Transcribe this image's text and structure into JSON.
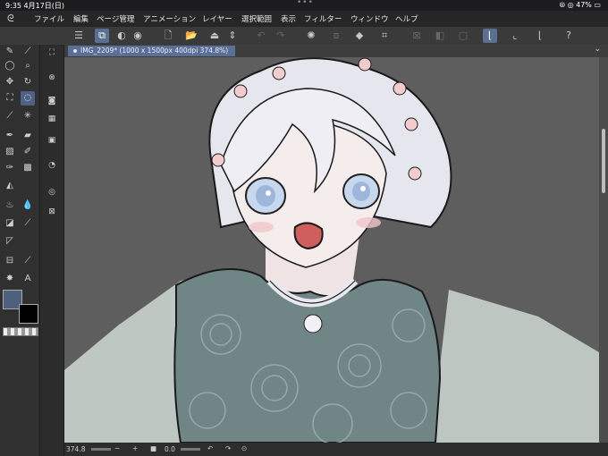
{
  "status_bar": {
    "time": "9:35",
    "date": "4月17日(日)",
    "battery": "47%"
  },
  "menu": {
    "items": [
      "ファイル",
      "編集",
      "ページ管理",
      "アニメーション",
      "レイヤー",
      "選択範囲",
      "表示",
      "フィルター",
      "ウィンドウ",
      "ヘルプ"
    ]
  },
  "document": {
    "tab_title": "IMG_2209* (1000 x 1500px 400dpi 374.8%)"
  },
  "bottom": {
    "zoom": "374.8",
    "rotation": "0.0"
  },
  "colors": {
    "main_color": "#4f5f7e",
    "sub_color": "#000000",
    "accent": "#5a6f96"
  },
  "icons": {
    "toolbar": [
      "menu-icon",
      "layer-select-icon",
      "view-icon",
      "new-icon",
      "open-icon",
      "save-icon",
      "arrows-icon",
      "undo-icon",
      "redo-icon",
      "spinner-icon",
      "copy-icon",
      "fill-icon",
      "transform-icon",
      "deselect-icon",
      "invert-icon",
      "border-icon",
      "ruler-snap-icon",
      "ruler-snap2-icon",
      "ruler-snap3-icon",
      "help-icon"
    ]
  }
}
